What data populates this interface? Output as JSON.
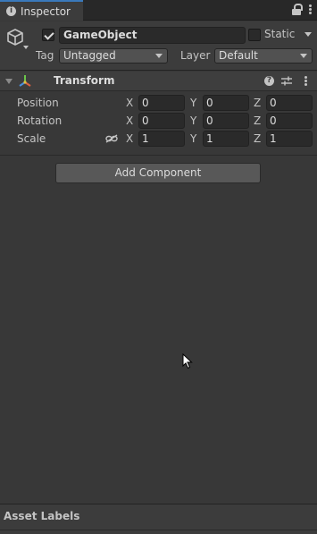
{
  "tab": {
    "label": "Inspector"
  },
  "object": {
    "active": true,
    "name": "GameObject",
    "static_label": "Static",
    "static": false,
    "tag_label": "Tag",
    "tag_value": "Untagged",
    "layer_label": "Layer",
    "layer_value": "Default"
  },
  "transform": {
    "title": "Transform",
    "rows": [
      {
        "label": "Position",
        "x": "0",
        "y": "0",
        "z": "0"
      },
      {
        "label": "Rotation",
        "x": "0",
        "y": "0",
        "z": "0"
      },
      {
        "label": "Scale",
        "x": "1",
        "y": "1",
        "z": "1"
      }
    ],
    "axes": {
      "x": "X",
      "y": "Y",
      "z": "Z"
    }
  },
  "add_component_label": "Add Component",
  "asset_labels_title": "Asset Labels",
  "colors": {
    "tab_accent": "#3a79bb",
    "panel_bg": "#383838"
  }
}
